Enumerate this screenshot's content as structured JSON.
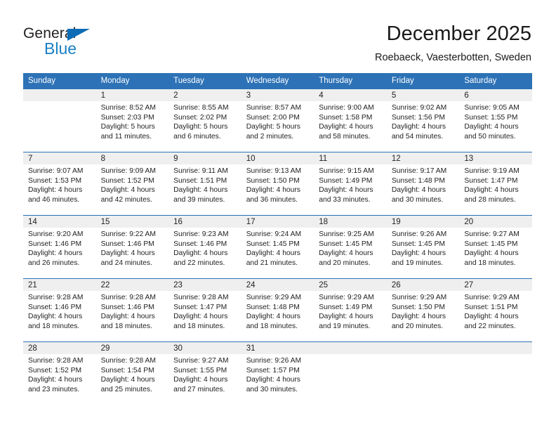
{
  "brand": {
    "name_top": "General",
    "name_bottom": "Blue",
    "triangle_color": "#0c6cb5",
    "blue_color": "#1b7fc4",
    "top_color": "#231f20"
  },
  "header": {
    "title": "December 2025",
    "location": "Roebaeck, Vaesterbotten, Sweden"
  },
  "theme": {
    "header_blue": "#2d72b6",
    "band_gray": "#efefef",
    "text": "#222222"
  },
  "weekdays": [
    "Sunday",
    "Monday",
    "Tuesday",
    "Wednesday",
    "Thursday",
    "Friday",
    "Saturday"
  ],
  "weeks": [
    [
      {
        "day": "",
        "sunrise": "",
        "sunset": "",
        "daylight1": "",
        "daylight2": ""
      },
      {
        "day": "1",
        "sunrise": "Sunrise: 8:52 AM",
        "sunset": "Sunset: 2:03 PM",
        "daylight1": "Daylight: 5 hours",
        "daylight2": "and 11 minutes."
      },
      {
        "day": "2",
        "sunrise": "Sunrise: 8:55 AM",
        "sunset": "Sunset: 2:02 PM",
        "daylight1": "Daylight: 5 hours",
        "daylight2": "and 6 minutes."
      },
      {
        "day": "3",
        "sunrise": "Sunrise: 8:57 AM",
        "sunset": "Sunset: 2:00 PM",
        "daylight1": "Daylight: 5 hours",
        "daylight2": "and 2 minutes."
      },
      {
        "day": "4",
        "sunrise": "Sunrise: 9:00 AM",
        "sunset": "Sunset: 1:58 PM",
        "daylight1": "Daylight: 4 hours",
        "daylight2": "and 58 minutes."
      },
      {
        "day": "5",
        "sunrise": "Sunrise: 9:02 AM",
        "sunset": "Sunset: 1:56 PM",
        "daylight1": "Daylight: 4 hours",
        "daylight2": "and 54 minutes."
      },
      {
        "day": "6",
        "sunrise": "Sunrise: 9:05 AM",
        "sunset": "Sunset: 1:55 PM",
        "daylight1": "Daylight: 4 hours",
        "daylight2": "and 50 minutes."
      }
    ],
    [
      {
        "day": "7",
        "sunrise": "Sunrise: 9:07 AM",
        "sunset": "Sunset: 1:53 PM",
        "daylight1": "Daylight: 4 hours",
        "daylight2": "and 46 minutes."
      },
      {
        "day": "8",
        "sunrise": "Sunrise: 9:09 AM",
        "sunset": "Sunset: 1:52 PM",
        "daylight1": "Daylight: 4 hours",
        "daylight2": "and 42 minutes."
      },
      {
        "day": "9",
        "sunrise": "Sunrise: 9:11 AM",
        "sunset": "Sunset: 1:51 PM",
        "daylight1": "Daylight: 4 hours",
        "daylight2": "and 39 minutes."
      },
      {
        "day": "10",
        "sunrise": "Sunrise: 9:13 AM",
        "sunset": "Sunset: 1:50 PM",
        "daylight1": "Daylight: 4 hours",
        "daylight2": "and 36 minutes."
      },
      {
        "day": "11",
        "sunrise": "Sunrise: 9:15 AM",
        "sunset": "Sunset: 1:49 PM",
        "daylight1": "Daylight: 4 hours",
        "daylight2": "and 33 minutes."
      },
      {
        "day": "12",
        "sunrise": "Sunrise: 9:17 AM",
        "sunset": "Sunset: 1:48 PM",
        "daylight1": "Daylight: 4 hours",
        "daylight2": "and 30 minutes."
      },
      {
        "day": "13",
        "sunrise": "Sunrise: 9:19 AM",
        "sunset": "Sunset: 1:47 PM",
        "daylight1": "Daylight: 4 hours",
        "daylight2": "and 28 minutes."
      }
    ],
    [
      {
        "day": "14",
        "sunrise": "Sunrise: 9:20 AM",
        "sunset": "Sunset: 1:46 PM",
        "daylight1": "Daylight: 4 hours",
        "daylight2": "and 26 minutes."
      },
      {
        "day": "15",
        "sunrise": "Sunrise: 9:22 AM",
        "sunset": "Sunset: 1:46 PM",
        "daylight1": "Daylight: 4 hours",
        "daylight2": "and 24 minutes."
      },
      {
        "day": "16",
        "sunrise": "Sunrise: 9:23 AM",
        "sunset": "Sunset: 1:46 PM",
        "daylight1": "Daylight: 4 hours",
        "daylight2": "and 22 minutes."
      },
      {
        "day": "17",
        "sunrise": "Sunrise: 9:24 AM",
        "sunset": "Sunset: 1:45 PM",
        "daylight1": "Daylight: 4 hours",
        "daylight2": "and 21 minutes."
      },
      {
        "day": "18",
        "sunrise": "Sunrise: 9:25 AM",
        "sunset": "Sunset: 1:45 PM",
        "daylight1": "Daylight: 4 hours",
        "daylight2": "and 20 minutes."
      },
      {
        "day": "19",
        "sunrise": "Sunrise: 9:26 AM",
        "sunset": "Sunset: 1:45 PM",
        "daylight1": "Daylight: 4 hours",
        "daylight2": "and 19 minutes."
      },
      {
        "day": "20",
        "sunrise": "Sunrise: 9:27 AM",
        "sunset": "Sunset: 1:45 PM",
        "daylight1": "Daylight: 4 hours",
        "daylight2": "and 18 minutes."
      }
    ],
    [
      {
        "day": "21",
        "sunrise": "Sunrise: 9:28 AM",
        "sunset": "Sunset: 1:46 PM",
        "daylight1": "Daylight: 4 hours",
        "daylight2": "and 18 minutes."
      },
      {
        "day": "22",
        "sunrise": "Sunrise: 9:28 AM",
        "sunset": "Sunset: 1:46 PM",
        "daylight1": "Daylight: 4 hours",
        "daylight2": "and 18 minutes."
      },
      {
        "day": "23",
        "sunrise": "Sunrise: 9:28 AM",
        "sunset": "Sunset: 1:47 PM",
        "daylight1": "Daylight: 4 hours",
        "daylight2": "and 18 minutes."
      },
      {
        "day": "24",
        "sunrise": "Sunrise: 9:29 AM",
        "sunset": "Sunset: 1:48 PM",
        "daylight1": "Daylight: 4 hours",
        "daylight2": "and 18 minutes."
      },
      {
        "day": "25",
        "sunrise": "Sunrise: 9:29 AM",
        "sunset": "Sunset: 1:49 PM",
        "daylight1": "Daylight: 4 hours",
        "daylight2": "and 19 minutes."
      },
      {
        "day": "26",
        "sunrise": "Sunrise: 9:29 AM",
        "sunset": "Sunset: 1:50 PM",
        "daylight1": "Daylight: 4 hours",
        "daylight2": "and 20 minutes."
      },
      {
        "day": "27",
        "sunrise": "Sunrise: 9:29 AM",
        "sunset": "Sunset: 1:51 PM",
        "daylight1": "Daylight: 4 hours",
        "daylight2": "and 22 minutes."
      }
    ],
    [
      {
        "day": "28",
        "sunrise": "Sunrise: 9:28 AM",
        "sunset": "Sunset: 1:52 PM",
        "daylight1": "Daylight: 4 hours",
        "daylight2": "and 23 minutes."
      },
      {
        "day": "29",
        "sunrise": "Sunrise: 9:28 AM",
        "sunset": "Sunset: 1:54 PM",
        "daylight1": "Daylight: 4 hours",
        "daylight2": "and 25 minutes."
      },
      {
        "day": "30",
        "sunrise": "Sunrise: 9:27 AM",
        "sunset": "Sunset: 1:55 PM",
        "daylight1": "Daylight: 4 hours",
        "daylight2": "and 27 minutes."
      },
      {
        "day": "31",
        "sunrise": "Sunrise: 9:26 AM",
        "sunset": "Sunset: 1:57 PM",
        "daylight1": "Daylight: 4 hours",
        "daylight2": "and 30 minutes."
      },
      {
        "day": "",
        "sunrise": "",
        "sunset": "",
        "daylight1": "",
        "daylight2": ""
      },
      {
        "day": "",
        "sunrise": "",
        "sunset": "",
        "daylight1": "",
        "daylight2": ""
      },
      {
        "day": "",
        "sunrise": "",
        "sunset": "",
        "daylight1": "",
        "daylight2": ""
      }
    ]
  ]
}
